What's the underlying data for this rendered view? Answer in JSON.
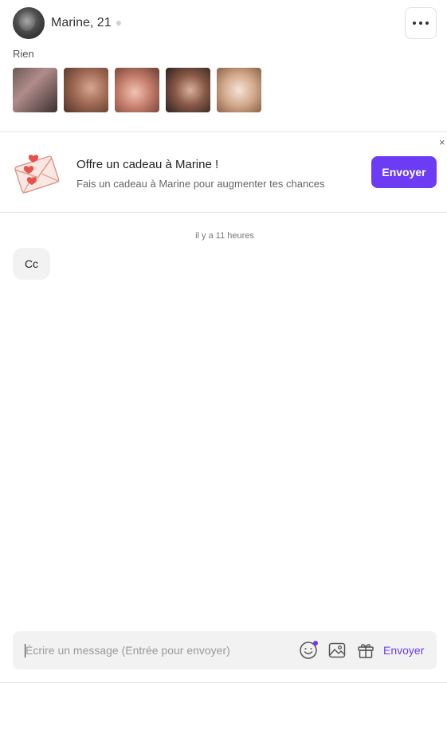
{
  "profile": {
    "name": "Marine, 21",
    "bio": "Rien",
    "photos": [
      "photo-1",
      "photo-2",
      "photo-3",
      "photo-4",
      "photo-5"
    ]
  },
  "gift_banner": {
    "title": "Offre un cadeau à Marine !",
    "subtitle": "Fais un cadeau à Marine pour augmenter tes chances",
    "button_label": "Envoyer",
    "close_label": "×",
    "icon": "love-letter-icon"
  },
  "conversation": {
    "timestamp": "il y a 11 heures",
    "messages": [
      {
        "text": "Cc"
      }
    ]
  },
  "composer": {
    "placeholder": "Écrire un message (Entrée pour envoyer)",
    "send_label": "Envoyer",
    "icons": [
      "emoji-icon",
      "image-icon",
      "gift-icon"
    ]
  },
  "colors": {
    "accent": "#6c3cf5",
    "bubble_bg": "#f2f2f2",
    "composer_bg": "#f2f2f2"
  }
}
